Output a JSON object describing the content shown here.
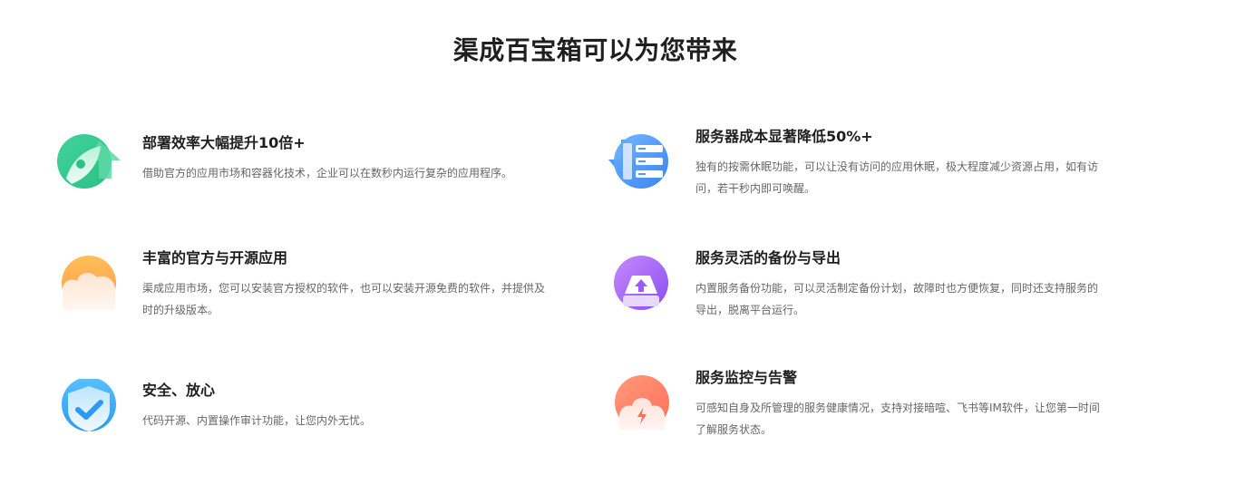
{
  "title": "渠成百宝箱可以为您带来",
  "features": [
    {
      "icon": "rocket-icon",
      "heading": "部署效率大幅提升10倍+",
      "description": "借助官方的应用市场和容器化技术，企业可以在数秒内运行复杂的应用程序。"
    },
    {
      "icon": "server-icon",
      "heading": "服务器成本显著降低50%+",
      "description": "独有的按需休眠功能，可以让没有访问的应用休眠，极大程度减少资源占用，如有访问，若干秒内即可唤醒。"
    },
    {
      "icon": "cloud-icon",
      "heading": "丰富的官方与开源应用",
      "description": "渠成应用市场，您可以安装官方授权的软件，也可以安装开源免费的软件，并提供及时的升级版本。"
    },
    {
      "icon": "backup-upload-icon",
      "heading": "服务灵活的备份与导出",
      "description": "内置服务备份功能，可以灵活制定备份计划，故障时也方便恢复，同时还支持服务的导出，脱离平台运行。"
    },
    {
      "icon": "shield-check-icon",
      "heading": "安全、放心",
      "description": "代码开源、内置操作审计功能，让您内外无忧。"
    },
    {
      "icon": "alert-bell-icon",
      "heading": "服务监控与告警",
      "description": "可感知自身及所管理的服务健康情况，支持对接暗喧、飞书等IM软件，让您第一时间了解服务状态。"
    }
  ]
}
